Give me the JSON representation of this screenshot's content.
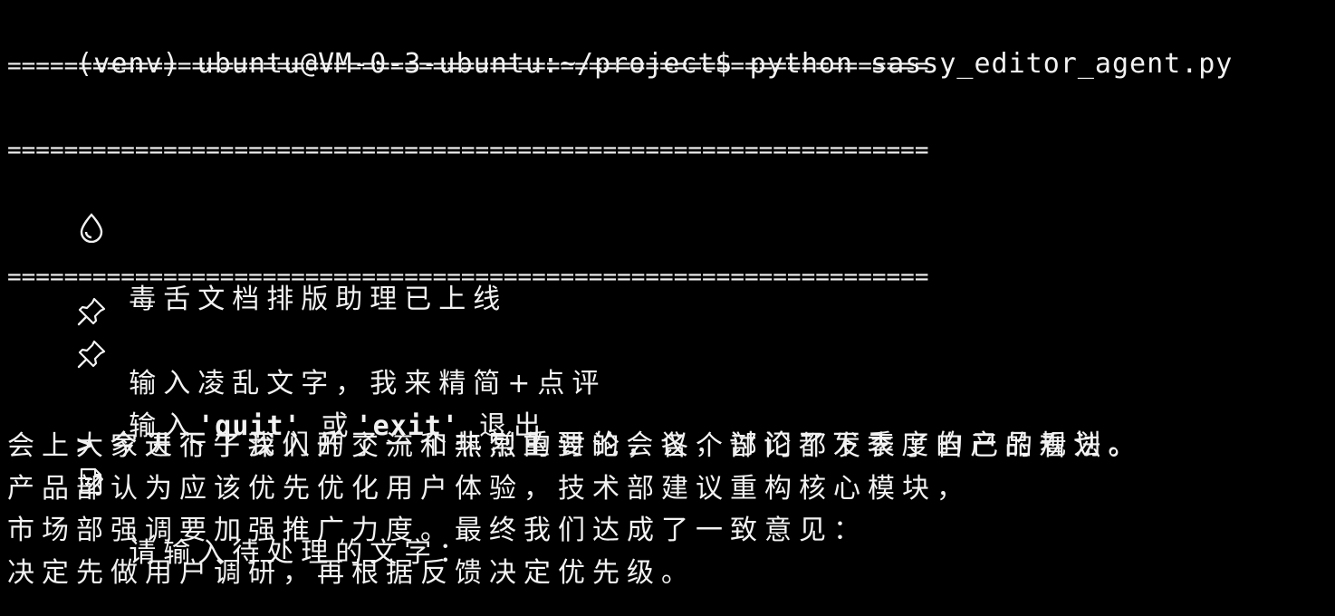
{
  "prompt": {
    "text": "(venv) ubuntu@VM-0-3-ubuntu:~/project$ python sassy_editor_agent.py"
  },
  "banner": {
    "rule": "=================================================================",
    "title_icon": "droplet-icon",
    "title": "毒舌文档排版助理已上线",
    "hint1_icon": "pushpin-icon",
    "hint1": "输入凌乱文字，我来精简+点评",
    "hint2_icon": "pushpin-icon",
    "hint2_prefix": "输入",
    "hint2_quit": "'quit'",
    "hint2_or": "或",
    "hint2_exit": "'exit'",
    "hint2_suffix": "退出"
  },
  "input": {
    "prompt_icon": "memo-icon",
    "prompt_label": "请输入待处理的文字：",
    "caret": ">",
    "lines": [
      "今天下午我们开了一个非常重要的会议，讨论了下季度的产品规划。",
      "会上大家进行了深入的交流和热烈的讨论，各个部门都发表了自己的看法。",
      "产品部认为应该优先优化用户体验，技术部建议重构核心模块，",
      "市场部强调要加强推广力度。最终我们达成了一致意见：",
      "决定先做用户调研，再根据反馈决定优先级。"
    ]
  },
  "colors": {
    "background": "#000000",
    "foreground": "#f2f2f2"
  }
}
